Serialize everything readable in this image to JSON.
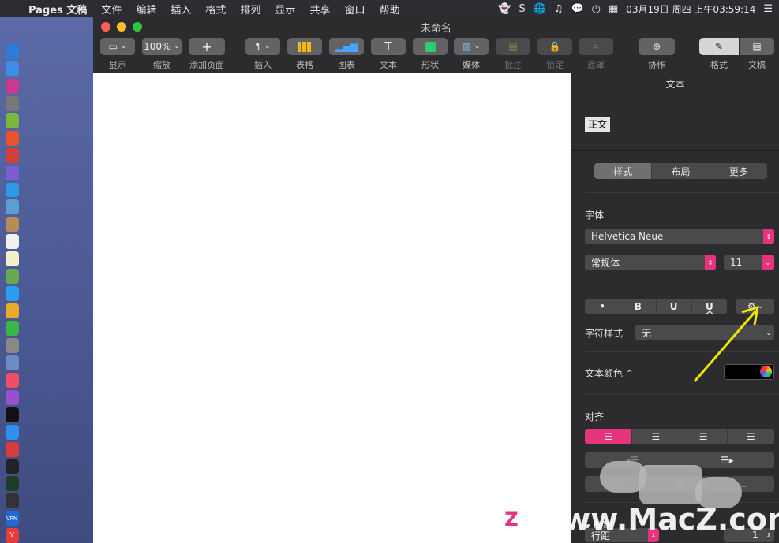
{
  "menubar": {
    "app_name": "Pages 文稿",
    "items": [
      "文件",
      "编辑",
      "插入",
      "格式",
      "排列",
      "显示",
      "共享",
      "窗口",
      "帮助"
    ],
    "clock": "03月19日 周四 上午03:59:14"
  },
  "window": {
    "title": "未命名"
  },
  "toolbar": {
    "view_label": "显示",
    "zoom_value": "100%",
    "zoom_label": "缩放",
    "add_page_label": "添加页面",
    "insert_label": "插入",
    "table_label": "表格",
    "chart_label": "图表",
    "text_label": "文本",
    "shape_label": "形状",
    "media_label": "媒体",
    "comment_label": "批注",
    "lock_label": "锁定",
    "mask_label": "遮罩",
    "collaborate_label": "协作",
    "format_label": "格式",
    "document_label": "文稿"
  },
  "inspector": {
    "title": "文本",
    "paragraph_style": "正文",
    "tabs": [
      "样式",
      "布局",
      "更多"
    ],
    "font_section": "字体",
    "font_family": "Helvetica Neue",
    "font_typeface": "常规体",
    "font_size": "11",
    "format_buttons": [
      "•",
      "B",
      "U",
      "U"
    ],
    "char_style_label": "字符样式",
    "char_style_value": "无",
    "text_color_label": "文本颜色 ⌃",
    "align_section": "对齐",
    "spacing_label": "间距",
    "line_spacing_label": "行距",
    "line_spacing_value": "1"
  },
  "watermark": {
    "text": "www.MacZ.com",
    "logo": "Z"
  },
  "colors": {
    "accent": "#e5337e",
    "window_bg": "#2c2c2e",
    "annotation_arrow": "#f5e600"
  }
}
